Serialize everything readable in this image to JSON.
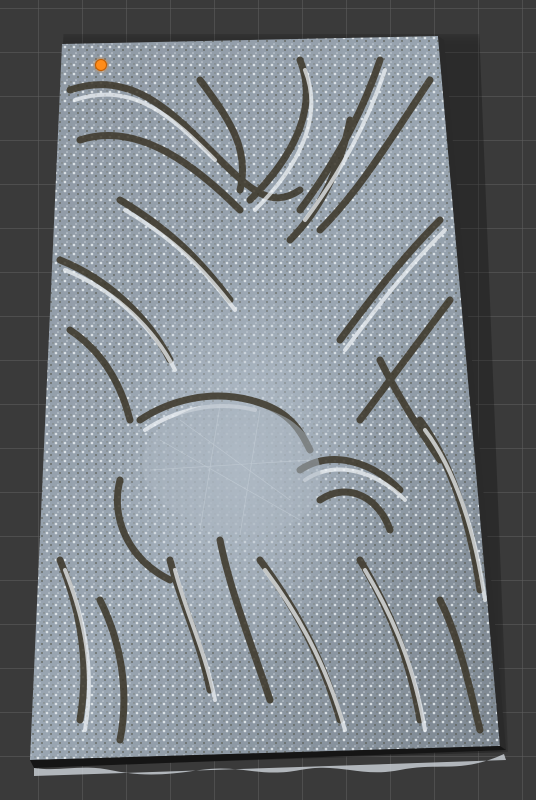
{
  "scene": {
    "object": "scanned-relief-slab",
    "colors": {
      "background": "#3a3a3a",
      "grid_line": "#5f5f5f",
      "surface_base": "#8a94a0",
      "surface_highlight": "#e9eef2",
      "surface_groove": "#3a3426",
      "origin_marker": "#ff8c1a",
      "base_edge": "#1a1a1a"
    },
    "icons": {
      "origin": "origin-dot-icon"
    }
  }
}
